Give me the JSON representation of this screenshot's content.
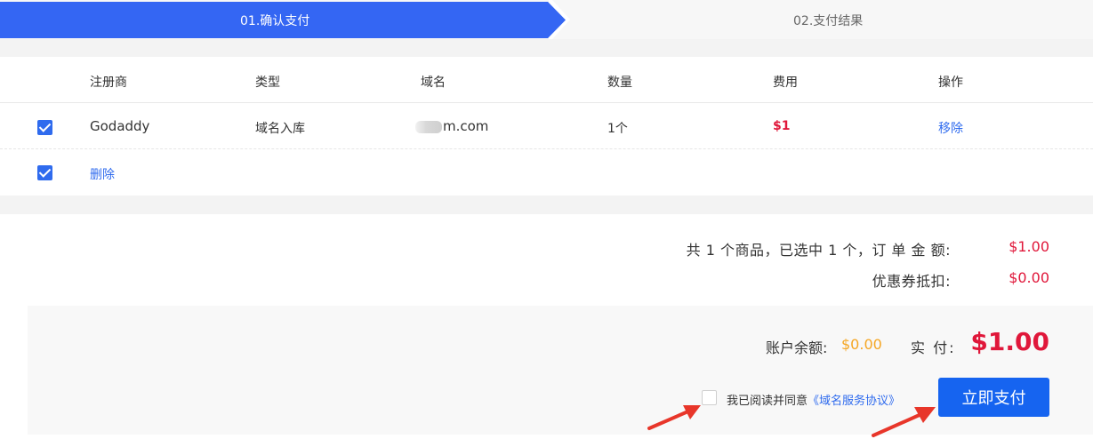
{
  "steps": [
    {
      "label": "01.确认支付",
      "active": true
    },
    {
      "label": "02.支付结果",
      "active": false
    }
  ],
  "table": {
    "headers": [
      "注册商",
      "类型",
      "域名",
      "数量",
      "费用",
      "操作"
    ],
    "rows": [
      {
        "checked": true,
        "registrar": "Godaddy",
        "type": "域名入库",
        "domain": "m.com",
        "quantity": "1个",
        "fee": "$1",
        "action": "移除"
      }
    ],
    "footer": {
      "checked": true,
      "delete_label": "删除"
    }
  },
  "summary": {
    "order_label": "共 1 个商品，已选中 1 个，订 单 金 额:",
    "order_amount": "$1.00",
    "coupon_label": "优惠券抵扣:",
    "coupon_amount": "$0.00"
  },
  "payment": {
    "balance_label": "账户余额:",
    "balance_value": "$0.00",
    "actual_label": "实 付:",
    "actual_value": "$1.00",
    "agree_prefix": "我已阅读并同意",
    "agree_link": "《域名服务协议》",
    "agree_checked": false,
    "pay_button": "立即支付"
  },
  "colors": {
    "accent": "#3466f3",
    "price": "#e0173a",
    "balance": "#f5a623",
    "link": "#2f6bee",
    "annotation_arrow": "#e8362a"
  }
}
